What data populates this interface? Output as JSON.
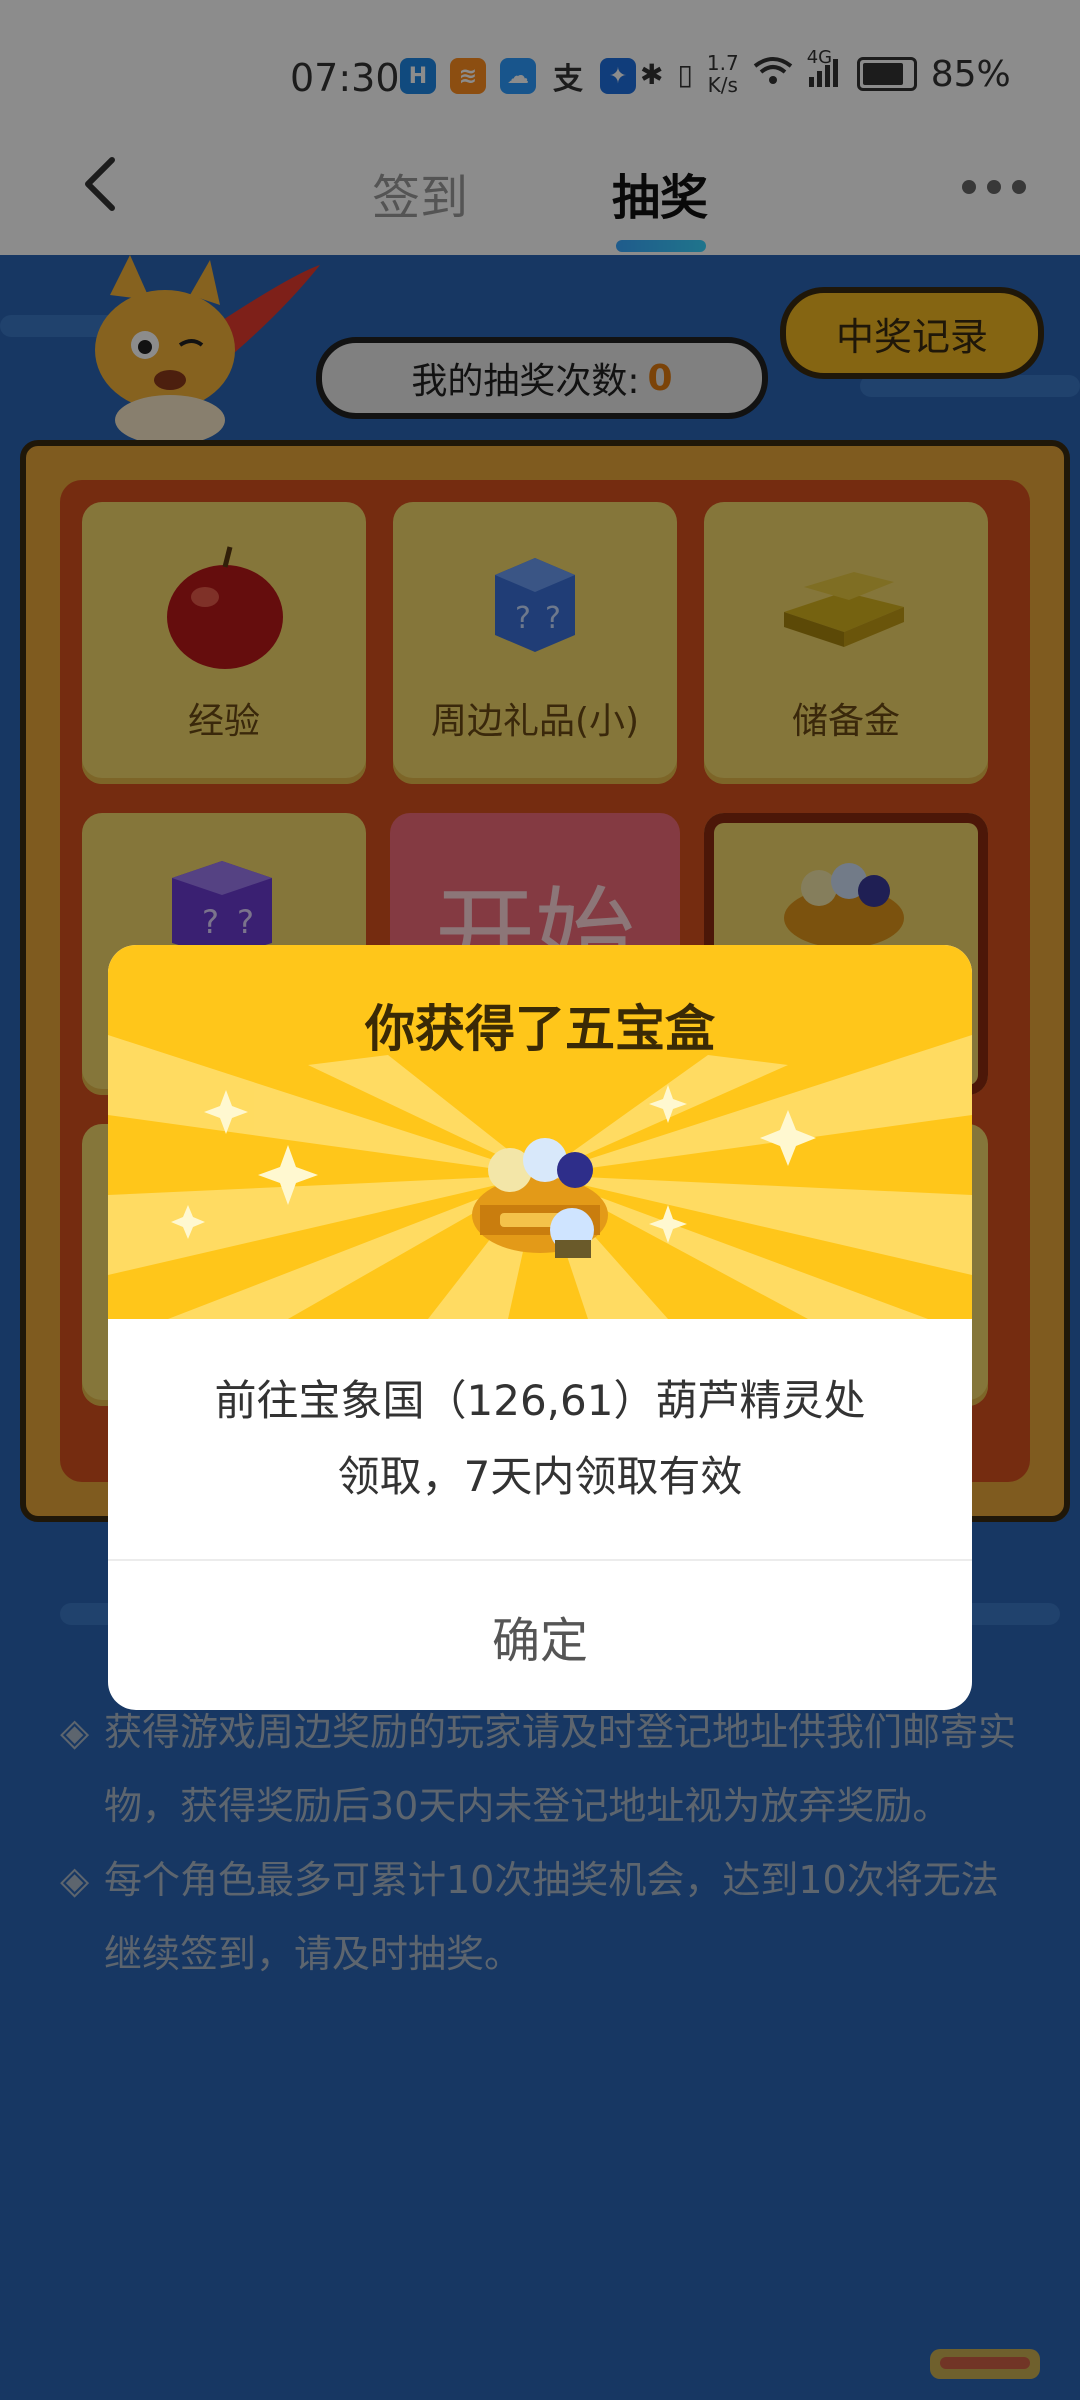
{
  "status_bar": {
    "time": "07:30",
    "net_speed_top": "1.7",
    "net_speed_unit": "K/s",
    "network": "4G",
    "battery": "85%",
    "app_icons": [
      "huawei-health-icon",
      "app-orange-icon",
      "weather-icon",
      "alipay-icon",
      "bulb-app-icon"
    ]
  },
  "nav": {
    "back_icon": "chevron-left-icon",
    "tabs": [
      {
        "label": "签到"
      },
      {
        "label": "抽奖"
      }
    ],
    "active_tab": "抽奖",
    "more_icon": "more-dots-icon"
  },
  "lottery": {
    "record_button": "中奖记录",
    "count_label": "我的抽奖次数:",
    "count_value": "0",
    "start_label": "开始",
    "prizes": [
      {
        "label": "经验",
        "icon": "apple-icon"
      },
      {
        "label": "周边礼品(小)",
        "icon": "blue-mystery-box-icon"
      },
      {
        "label": "储备金",
        "icon": "gold-bars-icon"
      },
      {
        "label": "",
        "icon": "purple-mystery-box-icon"
      },
      {
        "label": "",
        "icon": "treasure-pot-icon"
      }
    ]
  },
  "rules": [
    "获得游戏周边奖励的玩家请及时登记地址供我们邮寄实物，获得奖励后30天内未登记地址视为放弃奖励。",
    "每个角色最多可累计10次抽奖机会，达到10次将无法继续签到，请及时抽奖。"
  ],
  "rule_bullet": "◈",
  "modal": {
    "title": "你获得了五宝盒",
    "prize_icon": "treasure-pot-icon",
    "message_line1": "前往宝象国（126,61）葫芦精灵处",
    "message_line2": "领取，7天内领取有效",
    "confirm": "确定"
  },
  "colors": {
    "page_bg": "#2a65b5",
    "modal_header": "#ffc61a",
    "tab_indicator": "#39a7ff",
    "count_highlight": "#e07a10"
  }
}
